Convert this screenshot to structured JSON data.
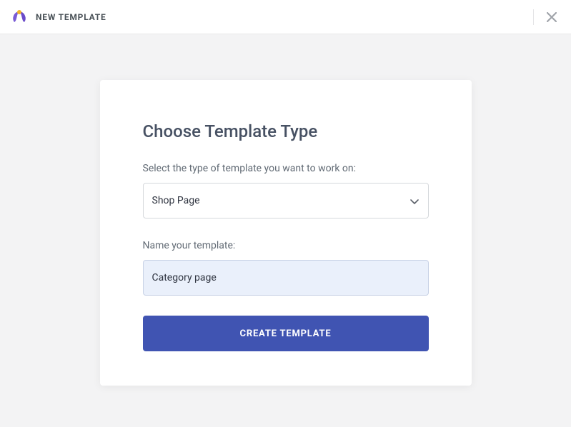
{
  "header": {
    "title": "NEW TEMPLATE"
  },
  "card": {
    "title": "Choose Template Type",
    "select_label": "Select the type of template you want to work on:",
    "select_value": "Shop Page",
    "name_label": "Name your template:",
    "name_value": "Category page",
    "create_button_label": "CREATE TEMPLATE"
  }
}
